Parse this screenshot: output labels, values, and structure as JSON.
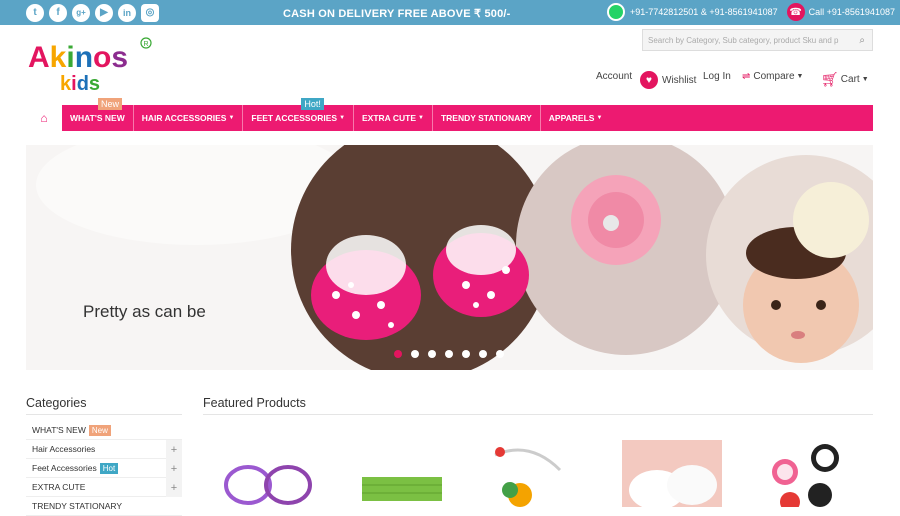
{
  "topbar": {
    "social": [
      "twitter-icon",
      "facebook-icon",
      "google-plus-icon",
      "youtube-icon",
      "linkedin-icon",
      "instagram-icon"
    ],
    "promo": "CASH ON DELIVERY FREE ABOVE ₹ 500/-",
    "whatsapp": "+91-7742812501 & +91-8561941087",
    "call": "Call +91-8561941087"
  },
  "logo": {
    "text": "AKINOS KIDS",
    "reg": "®"
  },
  "search": {
    "placeholder": "Search by Category, Sub category, product Sku and p"
  },
  "header": {
    "account": "Account",
    "wishlist": "Wishlist",
    "login": "Log In",
    "compare": "Compare",
    "cart": "Cart"
  },
  "nav": {
    "items": [
      {
        "label": "WHAT'S NEW",
        "badge": "New"
      },
      {
        "label": "HAIR ACCESSORIES"
      },
      {
        "label": "FEET ACCESSORIES",
        "badge": "Hot!"
      },
      {
        "label": "EXTRA CUTE"
      },
      {
        "label": "TRENDY STATIONARY"
      },
      {
        "label": "APPARELS"
      }
    ]
  },
  "hero": {
    "tagline": "Pretty as can be",
    "slides": 7,
    "active_slide": 1
  },
  "sidebar": {
    "title": "Categories",
    "items": [
      {
        "label": "WHAT'S NEW",
        "tag": "New"
      },
      {
        "label": "Hair Accessories"
      },
      {
        "label": "Feet Accessories",
        "tag": "Hot"
      },
      {
        "label": "EXTRA CUTE"
      },
      {
        "label": "TRENDY STATIONARY"
      }
    ]
  },
  "featured": {
    "title": "Featured Products"
  },
  "colors": {
    "pink": "#ed1a71",
    "blue": "#5ba4c6",
    "orange": "#f0a37a",
    "teal": "#3fa7c5"
  }
}
